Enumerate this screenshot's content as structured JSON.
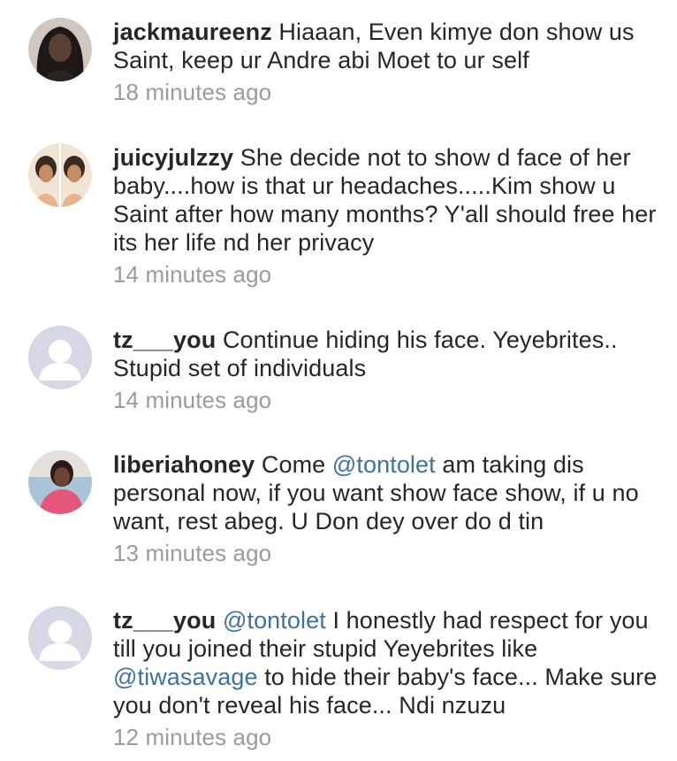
{
  "comments": [
    {
      "username": "jackmaureenz",
      "text_parts": [
        {
          "t": " Hiaaan, Even kimye don show us Saint, keep ur Andre abi Moet to ur self",
          "m": false
        }
      ],
      "time": "18 minutes ago",
      "avatar": "photo-woman-dark"
    },
    {
      "username": "juicyjulzzy",
      "text_parts": [
        {
          "t": " She decide not to show d face of her baby....how is that ur headaches.....Kim show u Saint after how many months? Y'all should free her its her life nd her privacy",
          "m": false
        }
      ],
      "time": "14 minutes ago",
      "avatar": "photo-woman-duo"
    },
    {
      "username": "tz___you",
      "text_parts": [
        {
          "t": " Continue hiding his face. Yeyebrites.. Stupid set of individuals",
          "m": false
        }
      ],
      "time": "14 minutes ago",
      "avatar": "default-user-icon"
    },
    {
      "username": "liberiahoney",
      "text_parts": [
        {
          "t": " Come  ",
          "m": false
        },
        {
          "t": "@tontolet",
          "m": true
        },
        {
          "t": " am taking dis personal now,  if you  want show face show, if u no want, rest abeg. U Don dey over do d tin",
          "m": false
        }
      ],
      "time": "13 minutes ago",
      "avatar": "photo-woman-pink"
    },
    {
      "username": "tz___you",
      "text_parts": [
        {
          "t": " ",
          "m": false
        },
        {
          "t": "@tontolet",
          "m": true
        },
        {
          "t": " I honestly had respect for you till you joined their stupid Yeyebrites like ",
          "m": false
        },
        {
          "t": "@tiwasavage",
          "m": true
        },
        {
          "t": " to hide their baby's face... Make sure you don't reveal his face... Ndi nzuzu",
          "m": false
        }
      ],
      "time": "12 minutes ago",
      "avatar": "default-user-icon"
    }
  ],
  "colors": {
    "text": "#262626",
    "mention": "#3f729b",
    "timestamp": "#9b9b9b",
    "avatar_placeholder": "#d6d8e6"
  }
}
